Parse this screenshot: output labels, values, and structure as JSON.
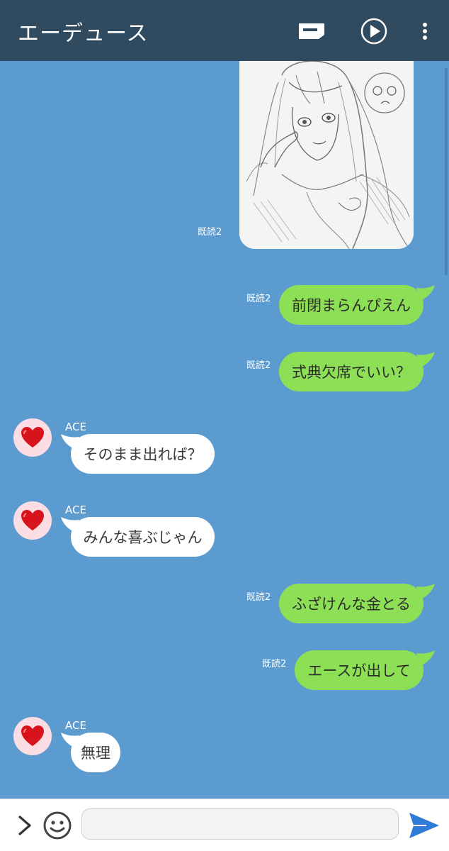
{
  "header": {
    "title": "エーデュース",
    "icons": [
      "note-icon",
      "play-icon",
      "more-vertical-icon"
    ]
  },
  "photo": {
    "read_receipt": "既読2"
  },
  "messages": [
    {
      "direction": "out",
      "text": "前閉まらんぴえん",
      "read": "既読2"
    },
    {
      "direction": "out",
      "text": "式典欠席でいい？",
      "read": "既読2"
    },
    {
      "direction": "in",
      "sender": "ACE",
      "text": "そのまま出れば？"
    },
    {
      "direction": "in",
      "sender": "ACE",
      "text": "みんな喜ぶじゃん"
    },
    {
      "direction": "out",
      "text": "ふざけんな金とる",
      "read": "既読2"
    },
    {
      "direction": "out",
      "text": "エースが出して",
      "read": "既読2"
    },
    {
      "direction": "in",
      "sender": "ACE",
      "text": "無理"
    }
  ],
  "composer": {
    "placeholder": "",
    "value": "",
    "icons": [
      "chevron-right-icon",
      "emoji-icon",
      "send-icon"
    ]
  },
  "colors": {
    "header_bg": "#304a5f",
    "chat_bg": "#5b9bd0",
    "outgoing_bubble": "#8de055",
    "incoming_bubble": "#ffffff",
    "send_icon": "#2f7cd8",
    "avatar_bg": "#fbdde3",
    "heart": "#d8131b"
  }
}
